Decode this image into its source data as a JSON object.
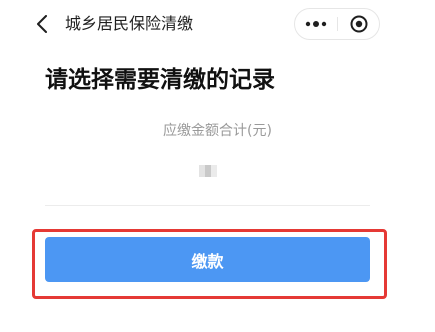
{
  "navbar": {
    "title": "城乡居民保险清缴",
    "back_icon": "chevron-left-icon",
    "capsule": {
      "more_icon": "more-dots-icon",
      "close_icon": "target-close-icon"
    }
  },
  "main": {
    "heading": "请选择需要清缴的记录",
    "amount_label": "应缴金额合计(元)",
    "amount_value_masked": true
  },
  "actions": {
    "pay_label": "缴款"
  },
  "colors": {
    "primary": "#4c97f3",
    "highlight": "#e53935",
    "muted_text": "#9a9a9a"
  }
}
